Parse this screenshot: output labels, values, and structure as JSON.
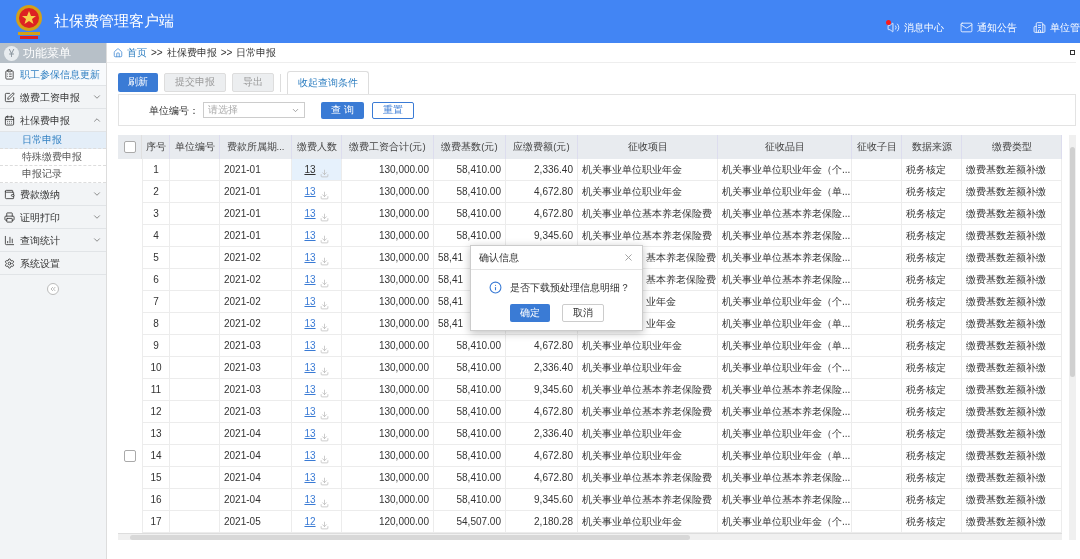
{
  "app": {
    "title": "社保费管理客户端"
  },
  "header_links": [
    {
      "kind": "message",
      "label": "消息中心",
      "unread": true
    },
    {
      "kind": "notice",
      "label": "通知公告"
    },
    {
      "kind": "unit",
      "label": "单位管"
    }
  ],
  "sidebar": {
    "icon_glyph": "¥",
    "title": "功能菜单",
    "items": [
      {
        "kind": "list",
        "label": "职工参保信息更新",
        "selected": true
      },
      {
        "kind": "edit",
        "label": "缴费工资申报",
        "selected": false,
        "expanded": false
      },
      {
        "kind": "calendar",
        "label": "社保费申报",
        "selected": false,
        "expanded": true,
        "children": [
          {
            "label": "日常申报",
            "selected": true
          },
          {
            "label": "特殊缴费申报",
            "selected": false
          },
          {
            "label": "申报记录",
            "selected": false
          }
        ]
      },
      {
        "kind": "wallet",
        "label": "费款缴纳",
        "selected": false,
        "expanded": false
      },
      {
        "kind": "print",
        "label": "证明打印",
        "selected": false,
        "expanded": false
      },
      {
        "kind": "chart",
        "label": "查询统计",
        "selected": false,
        "expanded": false
      },
      {
        "kind": "gear",
        "label": "系统设置",
        "selected": false
      }
    ]
  },
  "breadcrumb": [
    {
      "label": "首页",
      "link": true
    },
    {
      "label": "社保费申报",
      "link": false
    },
    {
      "label": "日常申报",
      "link": false
    }
  ],
  "breadcrumb_separator": ">>",
  "toolbar": {
    "buttons": [
      {
        "label": "刷新",
        "disabled": false
      },
      {
        "label": "提交申报",
        "disabled": true
      },
      {
        "label": "导出",
        "disabled": true
      }
    ],
    "tab": "收起查询条件"
  },
  "filter": {
    "label": "单位编号：",
    "placeholder": "请选择",
    "buttons": [
      {
        "label": "查 询",
        "kind": "primary"
      },
      {
        "label": "重置",
        "kind": "outline"
      }
    ]
  },
  "table": {
    "select_all": {
      "checked": false
    },
    "columns": [
      "序号",
      "单位编号",
      "费款所属期...",
      "缴费人数",
      "缴费工资合计(元)",
      "缴费基数(元)",
      "应缴费额(元)",
      "征收项目",
      "征收品目",
      "征收子目",
      "数据来源",
      "缴费类型"
    ],
    "rows": [
      {
        "no": "1",
        "period": "2021-01",
        "count": "13",
        "selected": true,
        "wage": "130,000.00",
        "base": "58,410.00",
        "amount": "2,336.40",
        "item": "机关事业单位职业年金",
        "category": "机关事业单位职业年金（个...",
        "source": "税务核定",
        "type": "缴费基数差额补缴",
        "covered": false
      },
      {
        "no": "2",
        "period": "2021-01",
        "count": "13",
        "selected": false,
        "wage": "130,000.00",
        "base": "58,410.00",
        "amount": "4,672.80",
        "item": "机关事业单位职业年金",
        "category": "机关事业单位职业年金（单...",
        "source": "税务核定",
        "type": "缴费基数差额补缴",
        "covered": false
      },
      {
        "no": "3",
        "period": "2021-01",
        "count": "13",
        "selected": false,
        "wage": "130,000.00",
        "base": "58,410.00",
        "amount": "4,672.80",
        "item": "机关事业单位基本养老保险费",
        "category": "机关事业单位基本养老保险...",
        "source": "税务核定",
        "type": "缴费基数差额补缴",
        "covered": false
      },
      {
        "no": "4",
        "period": "2021-01",
        "count": "13",
        "selected": false,
        "wage": "130,000.00",
        "base": "58,410.00",
        "amount": "9,345.60",
        "item": "机关事业单位基本养老保险费",
        "category": "机关事业单位基本养老保险...",
        "source": "税务核定",
        "type": "缴费基数差额补缴",
        "covered": false
      },
      {
        "no": "5",
        "period": "2021-02",
        "count": "13",
        "selected": false,
        "wage": "130,000.00",
        "base": "58,41",
        "item": "基本养老保险费",
        "category": "机关事业单位基本养老保险...",
        "source": "税务核定",
        "type": "缴费基数差额补缴",
        "covered": true
      },
      {
        "no": "6",
        "period": "2021-02",
        "count": "13",
        "selected": false,
        "wage": "130,000.00",
        "base": "58,41",
        "item": "基本养老保险费",
        "category": "机关事业单位基本养老保险...",
        "source": "税务核定",
        "type": "缴费基数差额补缴",
        "covered": true
      },
      {
        "no": "7",
        "period": "2021-02",
        "count": "13",
        "selected": false,
        "wage": "130,000.00",
        "base": "58,41",
        "item": "业年金",
        "category": "机关事业单位职业年金（个...",
        "source": "税务核定",
        "type": "缴费基数差额补缴",
        "covered": true
      },
      {
        "no": "8",
        "period": "2021-02",
        "count": "13",
        "selected": false,
        "wage": "130,000.00",
        "base": "58,41",
        "item": "业年金",
        "category": "机关事业单位职业年金（单...",
        "source": "税务核定",
        "type": "缴费基数差额补缴",
        "covered": true
      },
      {
        "no": "9",
        "period": "2021-03",
        "count": "13",
        "selected": false,
        "wage": "130,000.00",
        "base": "58,410.00",
        "amount": "4,672.80",
        "item": "机关事业单位职业年金",
        "category": "机关事业单位职业年金（单...",
        "source": "税务核定",
        "type": "缴费基数差额补缴",
        "covered": false
      },
      {
        "no": "10",
        "period": "2021-03",
        "count": "13",
        "selected": false,
        "wage": "130,000.00",
        "base": "58,410.00",
        "amount": "2,336.40",
        "item": "机关事业单位职业年金",
        "category": "机关事业单位职业年金（个...",
        "source": "税务核定",
        "type": "缴费基数差额补缴",
        "covered": false
      },
      {
        "no": "11",
        "period": "2021-03",
        "count": "13",
        "selected": false,
        "wage": "130,000.00",
        "base": "58,410.00",
        "amount": "9,345.60",
        "item": "机关事业单位基本养老保险费",
        "category": "机关事业单位基本养老保险...",
        "source": "税务核定",
        "type": "缴费基数差额补缴",
        "covered": false
      },
      {
        "no": "12",
        "period": "2021-03",
        "count": "13",
        "selected": false,
        "wage": "130,000.00",
        "base": "58,410.00",
        "amount": "4,672.80",
        "item": "机关事业单位基本养老保险费",
        "category": "机关事业单位基本养老保险...",
        "source": "税务核定",
        "type": "缴费基数差额补缴",
        "covered": false
      },
      {
        "no": "13",
        "period": "2021-04",
        "count": "13",
        "selected": false,
        "wage": "130,000.00",
        "base": "58,410.00",
        "amount": "2,336.40",
        "item": "机关事业单位职业年金",
        "category": "机关事业单位职业年金（个...",
        "source": "税务核定",
        "type": "缴费基数差额补缴",
        "covered": false
      },
      {
        "no": "14",
        "period": "2021-04",
        "count": "13",
        "selected": false,
        "wage": "130,000.00",
        "base": "58,410.00",
        "amount": "4,672.80",
        "item": "机关事业单位职业年金",
        "category": "机关事业单位职业年金（单...",
        "source": "税务核定",
        "type": "缴费基数差额补缴",
        "covered": false,
        "checkbox": {
          "checked": false
        }
      },
      {
        "no": "15",
        "period": "2021-04",
        "count": "13",
        "selected": false,
        "wage": "130,000.00",
        "base": "58,410.00",
        "amount": "4,672.80",
        "item": "机关事业单位基本养老保险费",
        "category": "机关事业单位基本养老保险...",
        "source": "税务核定",
        "type": "缴费基数差额补缴",
        "covered": false
      },
      {
        "no": "16",
        "period": "2021-04",
        "count": "13",
        "selected": false,
        "wage": "130,000.00",
        "base": "58,410.00",
        "amount": "9,345.60",
        "item": "机关事业单位基本养老保险费",
        "category": "机关事业单位基本养老保险...",
        "source": "税务核定",
        "type": "缴费基数差额补缴",
        "covered": false
      },
      {
        "no": "17",
        "period": "2021-05",
        "count": "12",
        "selected": false,
        "wage": "120,000.00",
        "base": "54,507.00",
        "amount": "2,180.28",
        "item": "机关事业单位职业年金",
        "category": "机关事业单位职业年金（个...",
        "source": "税务核定",
        "type": "缴费基数差额补缴",
        "covered": false
      }
    ]
  },
  "dialog": {
    "title": "确认信息",
    "message": "是否下载预处理信息明细？",
    "buttons": [
      {
        "label": "确定",
        "kind": "primary"
      },
      {
        "label": "取消",
        "kind": "default"
      }
    ]
  }
}
